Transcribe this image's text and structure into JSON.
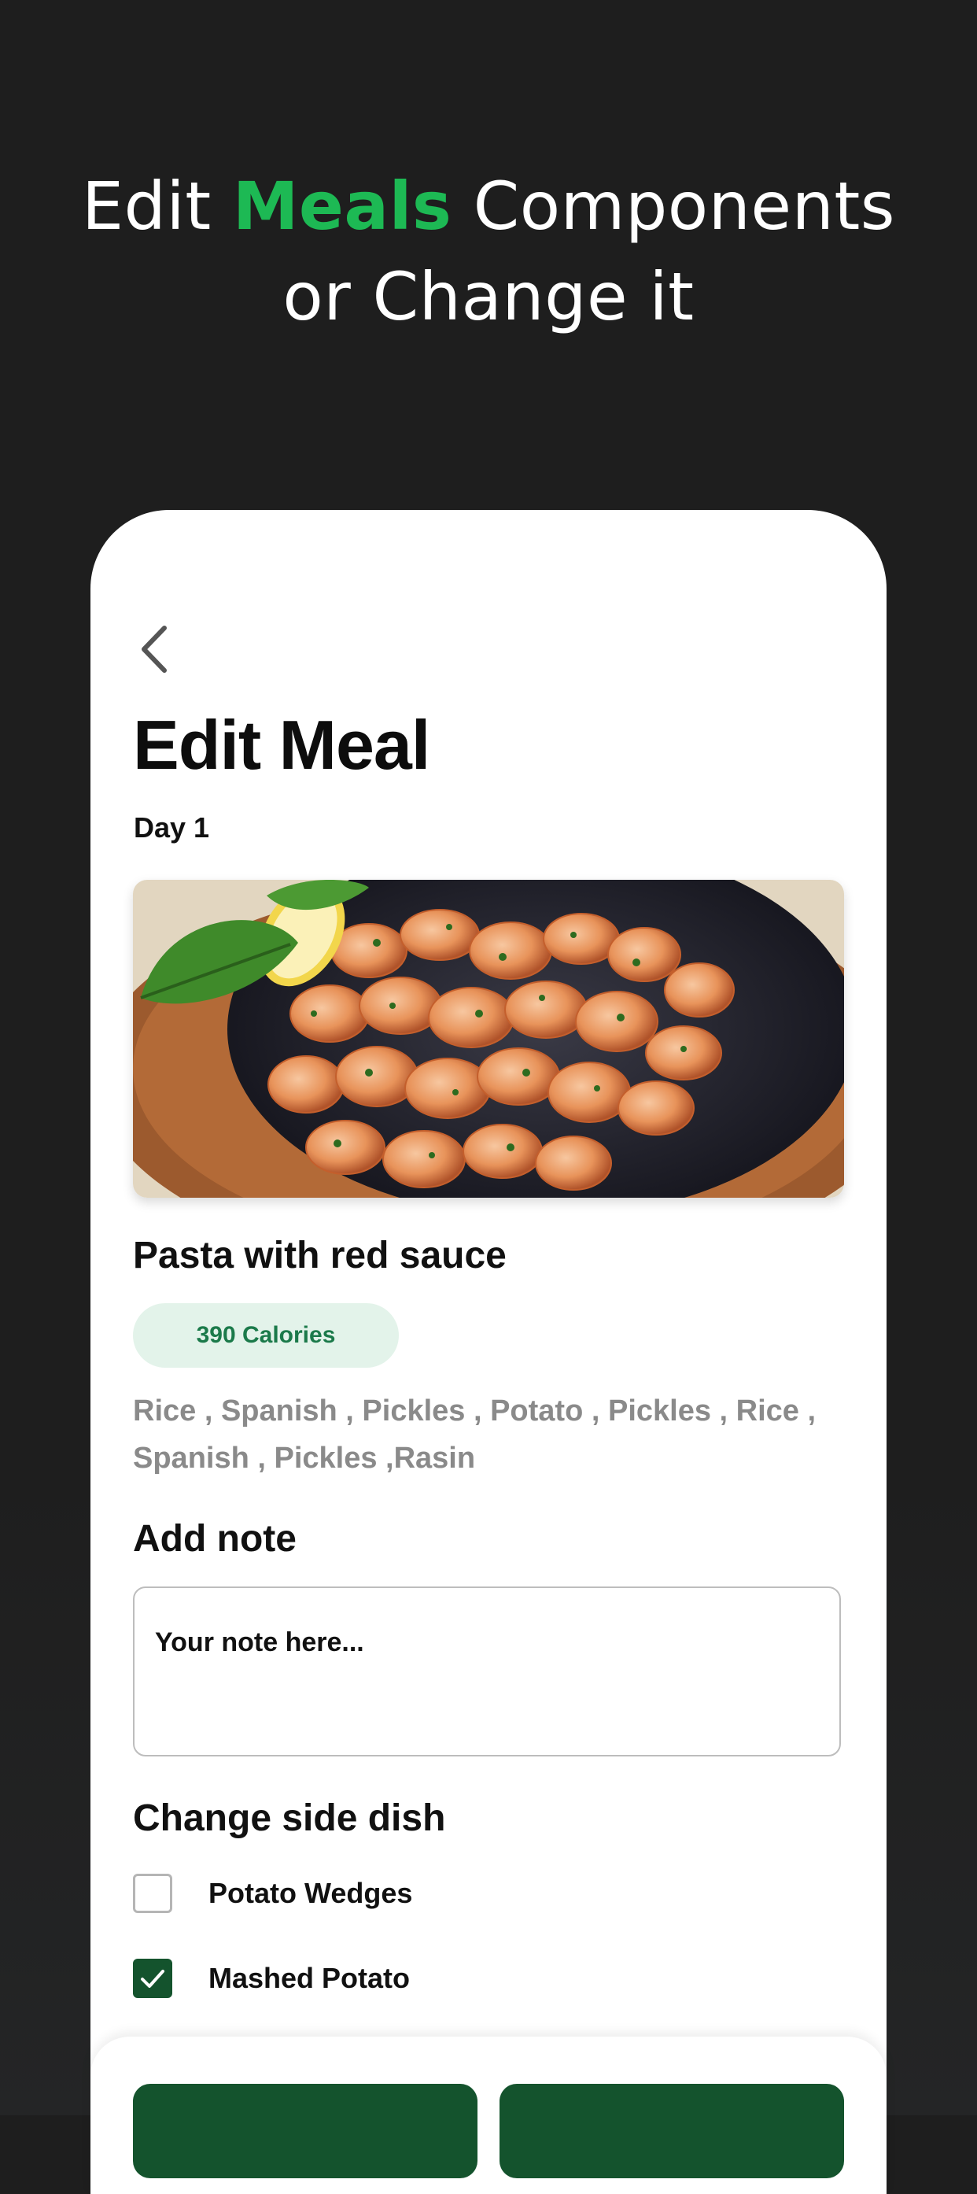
{
  "header": {
    "prefix": "Edit ",
    "accent": "Meals",
    "suffix": " Components",
    "line2": "or Change it"
  },
  "screen": {
    "title": "Edit Meal",
    "day": "Day 1",
    "meal": {
      "name": "Pasta with red sauce",
      "calories": "390 Calories",
      "ingredients": "Rice , Spanish , Pickles , Potato , Pickles , Rice , Spanish , Pickles ,Rasin"
    },
    "note": {
      "heading": "Add note",
      "placeholder": "Your note here..."
    },
    "side_dish": {
      "heading": "Change side dish",
      "options": [
        {
          "label": "Potato Wedges",
          "checked": false
        },
        {
          "label": "Mashed Potato",
          "checked": true
        }
      ]
    }
  },
  "colors": {
    "background": "#1e1e1e",
    "accent_green": "#1db954",
    "dark_green": "#14532d",
    "badge_bg": "#e3f3ea",
    "badge_text": "#1b7a4a"
  },
  "icons": {
    "back": "chevron-left-icon",
    "check": "checkmark-icon"
  }
}
